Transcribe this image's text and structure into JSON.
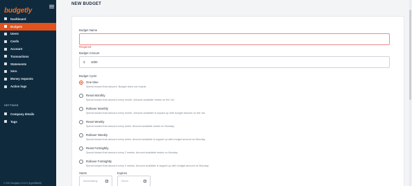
{
  "app": {
    "logo_text": "budgetly"
  },
  "sidebar": {
    "items": [
      {
        "label": "Dashboard",
        "icon": "dashboard-icon",
        "active": false
      },
      {
        "label": "Budgets",
        "icon": "budget-icon",
        "active": true
      },
      {
        "label": "Users",
        "icon": "users-icon",
        "active": false
      },
      {
        "label": "Cards",
        "icon": "card-icon",
        "active": false
      },
      {
        "label": "Account",
        "icon": "account-icon",
        "active": false
      },
      {
        "label": "Transactions",
        "icon": "transactions-icon",
        "active": false
      },
      {
        "label": "Statements",
        "icon": "statements-icon",
        "active": false
      },
      {
        "label": "Xero",
        "icon": "xero-icon",
        "active": false
      },
      {
        "label": "Money requests",
        "icon": "money-request-icon",
        "active": false
      },
      {
        "label": "Action logs",
        "icon": "action-log-icon",
        "active": false
      }
    ],
    "settings_label": "SETTINGS",
    "settings_items": [
      {
        "label": "Company details",
        "icon": "company-icon"
      },
      {
        "label": "Tags",
        "icon": "tag-icon"
      }
    ],
    "footer": "© 2021 Budgetly v3.13.0 (6 gb4f55a9f)"
  },
  "page": {
    "title": "NEW BUDGET"
  },
  "form": {
    "budget_name_label": "Budget Name",
    "budget_name_value": "",
    "budget_name_error": "Required",
    "budget_amount_label": "Budget Amount",
    "budget_amount_prefix": "$",
    "budget_amount_value": "1000",
    "budget_cycle_label": "Budget Cycle",
    "cycle_options": [
      {
        "title": "One-time",
        "desc": "Spend toward that amount. Budget does not repeat.",
        "selected": true
      },
      {
        "title": "Reset Monthly",
        "desc": "Spend toward that amount every month. Amount available resets on the 1st.",
        "selected": false
      },
      {
        "title": "Rollover Monthly",
        "desc": "Spend toward that amount every month. Amount available is topped up with budget amount on the 1st.",
        "selected": false
      },
      {
        "title": "Reset Weekly",
        "desc": "Spend toward that amount every week. Amount available resets on Monday.",
        "selected": false
      },
      {
        "title": "Rollover Weekly",
        "desc": "Spend toward that amount every week. Amount available is topped up with budget amount on Monday.",
        "selected": false
      },
      {
        "title": "Reset Fortnightly",
        "desc": "Spend toward that amount every 2 weeks. Amount available resets on Monday.",
        "selected": false
      },
      {
        "title": "Rollover Fortnightly",
        "desc": "Spend toward that amount every 2 weeks. Amount available is topped up with budget amount on Monday.",
        "selected": false
      }
    ],
    "starts_label": "Starts",
    "starts_placeholder": "Immediately",
    "expires_label": "Expires",
    "expires_placeholder": "Never"
  },
  "colors": {
    "sidebar_bg": "#0f2a3d",
    "accent": "#e2521e",
    "error": "#e04545"
  }
}
